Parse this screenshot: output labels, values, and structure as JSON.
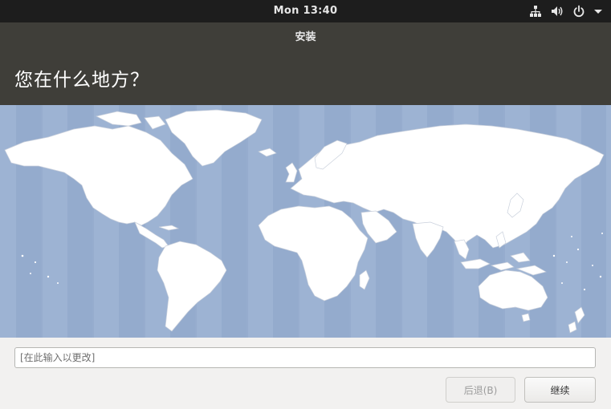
{
  "topbar": {
    "clock": "Mon 13:40",
    "icons": [
      "network-icon",
      "volume-icon",
      "power-icon",
      "menu-arrow-icon"
    ]
  },
  "window": {
    "title": "安装",
    "heading": "您在什么地方？"
  },
  "location": {
    "placeholder": "[在此输入以更改]",
    "value": ""
  },
  "buttons": {
    "back": "后退(B)",
    "continue": "继续"
  },
  "colors": {
    "topbar": "#1d1d1d",
    "header": "#3f3e39",
    "ocean": "#9db3d3",
    "land": "#ffffff",
    "background": "#f2f1f0"
  }
}
